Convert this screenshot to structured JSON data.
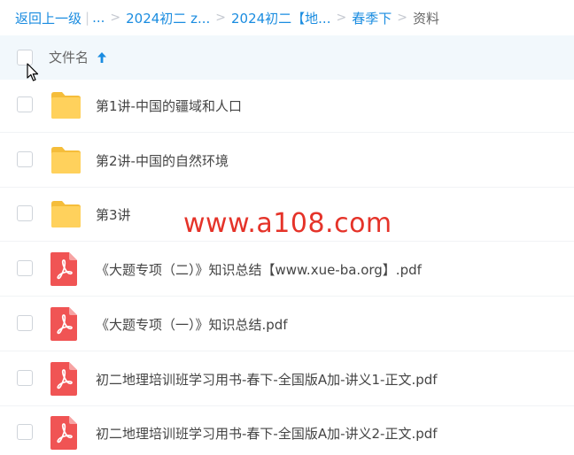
{
  "breadcrumb": {
    "back": "返回上一级",
    "ellipsis": "...",
    "items": [
      "2024初二 z...",
      "2024初二【地...",
      "春季下"
    ],
    "current": "资料"
  },
  "header": {
    "column_name": "文件名",
    "sort": "ascending"
  },
  "files": [
    {
      "name": "第1讲-中国的疆域和人口",
      "type": "folder"
    },
    {
      "name": "第2讲-中国的自然环境",
      "type": "folder"
    },
    {
      "name": "第3讲",
      "type": "folder"
    },
    {
      "name": "《大题专项（二）》知识总结【www.xue-ba.org】.pdf",
      "type": "pdf"
    },
    {
      "name": "《大题专项（一）》知识总结.pdf",
      "type": "pdf"
    },
    {
      "name": "初二地理培训班学习用书-春下-全国版A加-讲义1-正文.pdf",
      "type": "pdf"
    },
    {
      "name": "初二地理培训班学习用书-春下-全国版A加-讲义2-正文.pdf",
      "type": "pdf"
    }
  ],
  "watermark": "www.a108.com",
  "colors": {
    "link": "#1a8ce0",
    "header_bg": "#f2f8fc",
    "folder": "#ffd15c",
    "pdf": "#f05454",
    "watermark": "#e53329"
  }
}
